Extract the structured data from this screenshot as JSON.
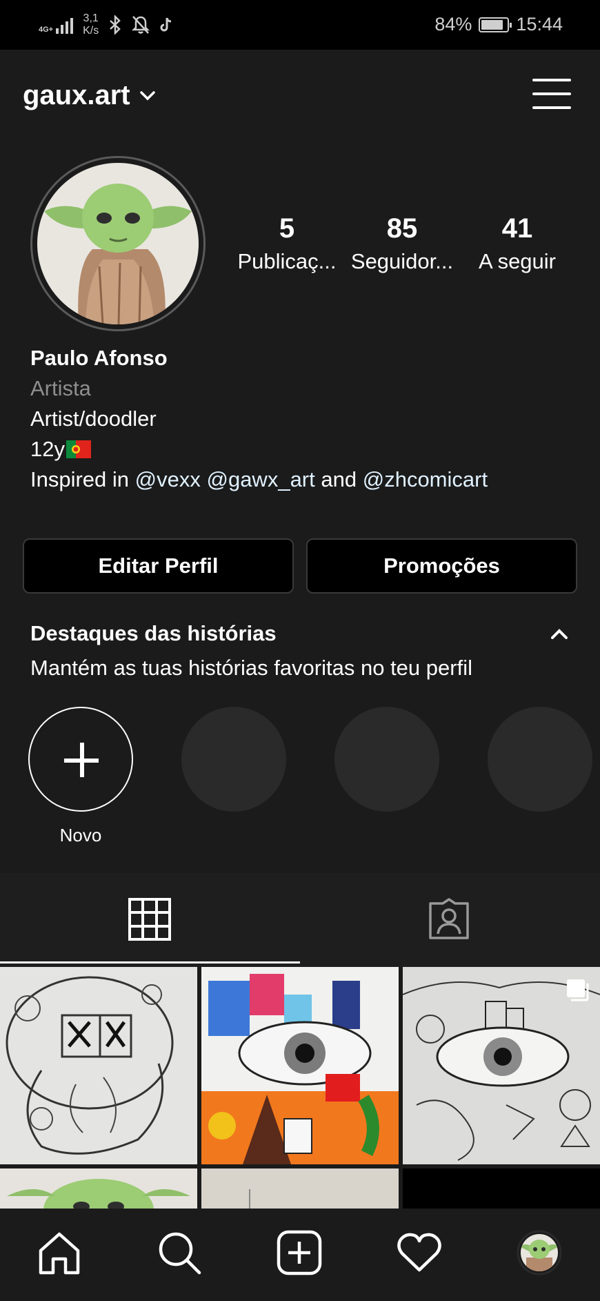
{
  "status_bar": {
    "network": "4G+",
    "speed_value": "3,1",
    "speed_unit": "K/s",
    "battery": "84%",
    "battery_level": 0.84,
    "time": "15:44"
  },
  "header": {
    "username": "gaux.art"
  },
  "profile": {
    "stats": [
      {
        "number": "5",
        "label": "Publicaç..."
      },
      {
        "number": "85",
        "label": "Seguidor..."
      },
      {
        "number": "41",
        "label": "A seguir"
      }
    ],
    "name": "Paulo Afonso",
    "category": "Artista",
    "bio_line1": "Artist/doodler",
    "bio_line2": "12y",
    "bio_line3_prefix": "Inspired in ",
    "mention_1": "@vexx",
    "mention_2": "@gawx_art",
    "and_word": "and",
    "mention_3": "@zhcomicart"
  },
  "buttons": {
    "edit_profile": "Editar Perfil",
    "promotions": "Promoções"
  },
  "highlights": {
    "title": "Destaques das histórias",
    "subtitle": "Mantém as tuas histórias favoritas no teu perfil",
    "new_label": "Novo"
  },
  "icons": {
    "dropdown": "chevron-down-icon",
    "menu": "hamburger-icon",
    "collapse": "chevron-up-icon",
    "grid_tab": "grid-icon",
    "tagged_tab": "tagged-person-icon",
    "multi_post": "carousel-icon",
    "nav": [
      "home-icon",
      "search-icon",
      "add-post-icon",
      "heart-icon",
      "profile-avatar-icon"
    ]
  },
  "colors": {
    "background": "#1b1b1b",
    "mention": "#e0f1ff",
    "secondary_text": "#8e8e8e"
  }
}
